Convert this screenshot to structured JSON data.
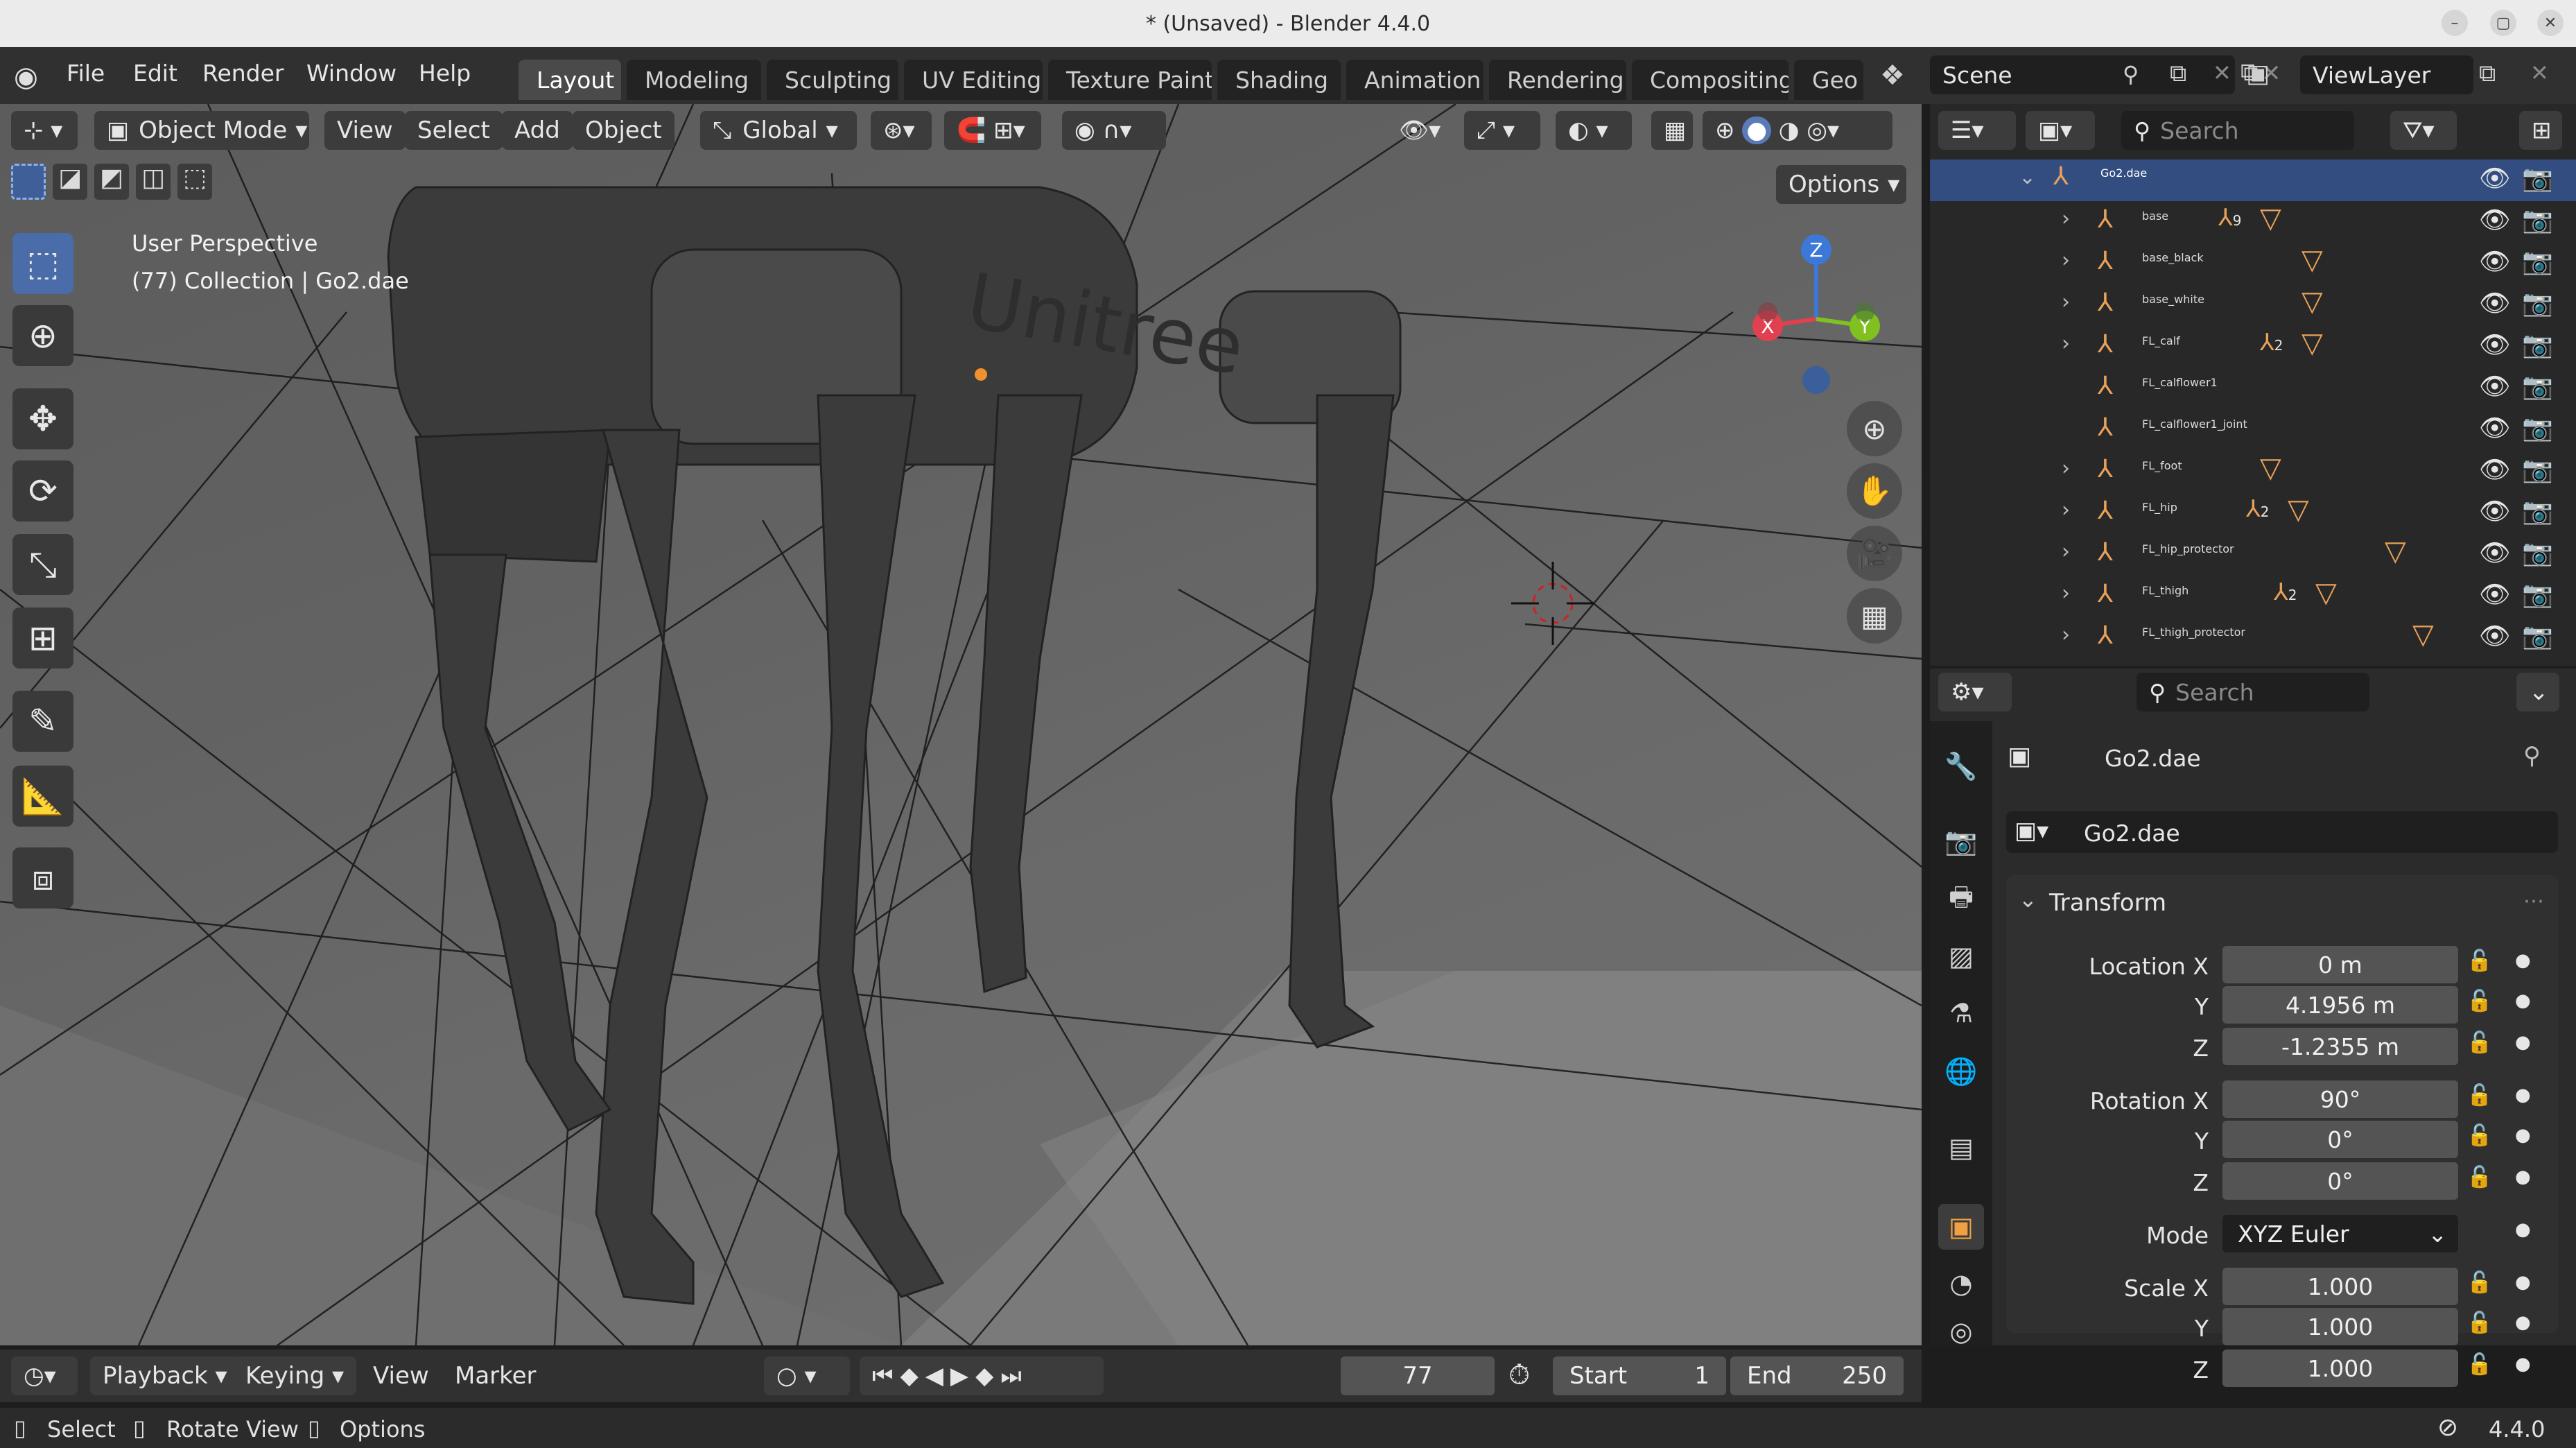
{
  "window": {
    "title": "* (Unsaved) - Blender 4.4.0",
    "minimize_icon": "minimize-icon",
    "maximize_icon": "maximize-icon",
    "close_icon": "close-icon"
  },
  "menu": [
    "File",
    "Edit",
    "Render",
    "Window",
    "Help"
  ],
  "workspaces": [
    "Layout",
    "Modeling",
    "Sculpting",
    "UV Editing",
    "Texture Paint",
    "Shading",
    "Animation",
    "Rendering",
    "Compositing",
    "Geo"
  ],
  "active_workspace": "Layout",
  "scene": {
    "name": "Scene",
    "view_layer": "ViewLayer"
  },
  "viewport": {
    "mode": "Object Mode",
    "menus": [
      "View",
      "Select",
      "Add",
      "Object"
    ],
    "orientation": "Global",
    "options_label": "Options",
    "overlay_line1": "User Perspective",
    "overlay_line2": "(77) Collection | Go2.dae",
    "axes": {
      "x": "X",
      "y": "Y",
      "z": "Z"
    },
    "tools": [
      "select-box-icon",
      "cursor-icon",
      "move-icon",
      "rotate-icon",
      "scale-icon",
      "transform-icon",
      "annotate-icon",
      "measure-icon",
      "add-cube-icon"
    ]
  },
  "outliner": {
    "search_placeholder": "Search",
    "root": "Go2.dae",
    "items": [
      {
        "label": "base",
        "badge": "9",
        "has_children": true,
        "mesh": true
      },
      {
        "label": "base_black",
        "badge": "",
        "has_children": true,
        "mesh": true
      },
      {
        "label": "base_white",
        "badge": "",
        "has_children": true,
        "mesh": true
      },
      {
        "label": "FL_calf",
        "badge": "2",
        "has_children": true,
        "mesh": true
      },
      {
        "label": "FL_calflower1",
        "badge": "",
        "has_children": false,
        "mesh": false
      },
      {
        "label": "FL_calflower1_joint",
        "badge": "",
        "has_children": false,
        "mesh": false
      },
      {
        "label": "FL_foot",
        "badge": "",
        "has_children": true,
        "mesh": true
      },
      {
        "label": "FL_hip",
        "badge": "2",
        "has_children": true,
        "mesh": true
      },
      {
        "label": "FL_hip_protector",
        "badge": "",
        "has_children": true,
        "mesh": true
      },
      {
        "label": "FL_thigh",
        "badge": "2",
        "has_children": true,
        "mesh": true
      },
      {
        "label": "FL_thigh_protector",
        "badge": "",
        "has_children": true,
        "mesh": true
      }
    ]
  },
  "properties": {
    "search_placeholder": "Search",
    "object_name": "Go2.dae",
    "datablock_name": "Go2.dae",
    "panel_title": "Transform",
    "location": {
      "label_x": "Location X",
      "label_y": "Y",
      "label_z": "Z",
      "x": "0 m",
      "y": "4.1956 m",
      "z": "-1.2355 m"
    },
    "rotation": {
      "label_x": "Rotation X",
      "label_y": "Y",
      "label_z": "Z",
      "x": "90°",
      "y": "0°",
      "z": "0°"
    },
    "mode": {
      "label": "Mode",
      "value": "XYZ Euler"
    },
    "scale": {
      "label_x": "Scale X",
      "label_y": "Y",
      "label_z": "Z",
      "x": "1.000",
      "y": "1.000",
      "z": "1.000"
    }
  },
  "timeline": {
    "menus": [
      "Playback",
      "Keying",
      "View",
      "Marker"
    ],
    "current_frame": "77",
    "start_label": "Start",
    "start": "1",
    "end_label": "End",
    "end": "250"
  },
  "status": {
    "select": "Select",
    "rotate": "Rotate View",
    "options": "Options",
    "version": "4.4.0"
  }
}
